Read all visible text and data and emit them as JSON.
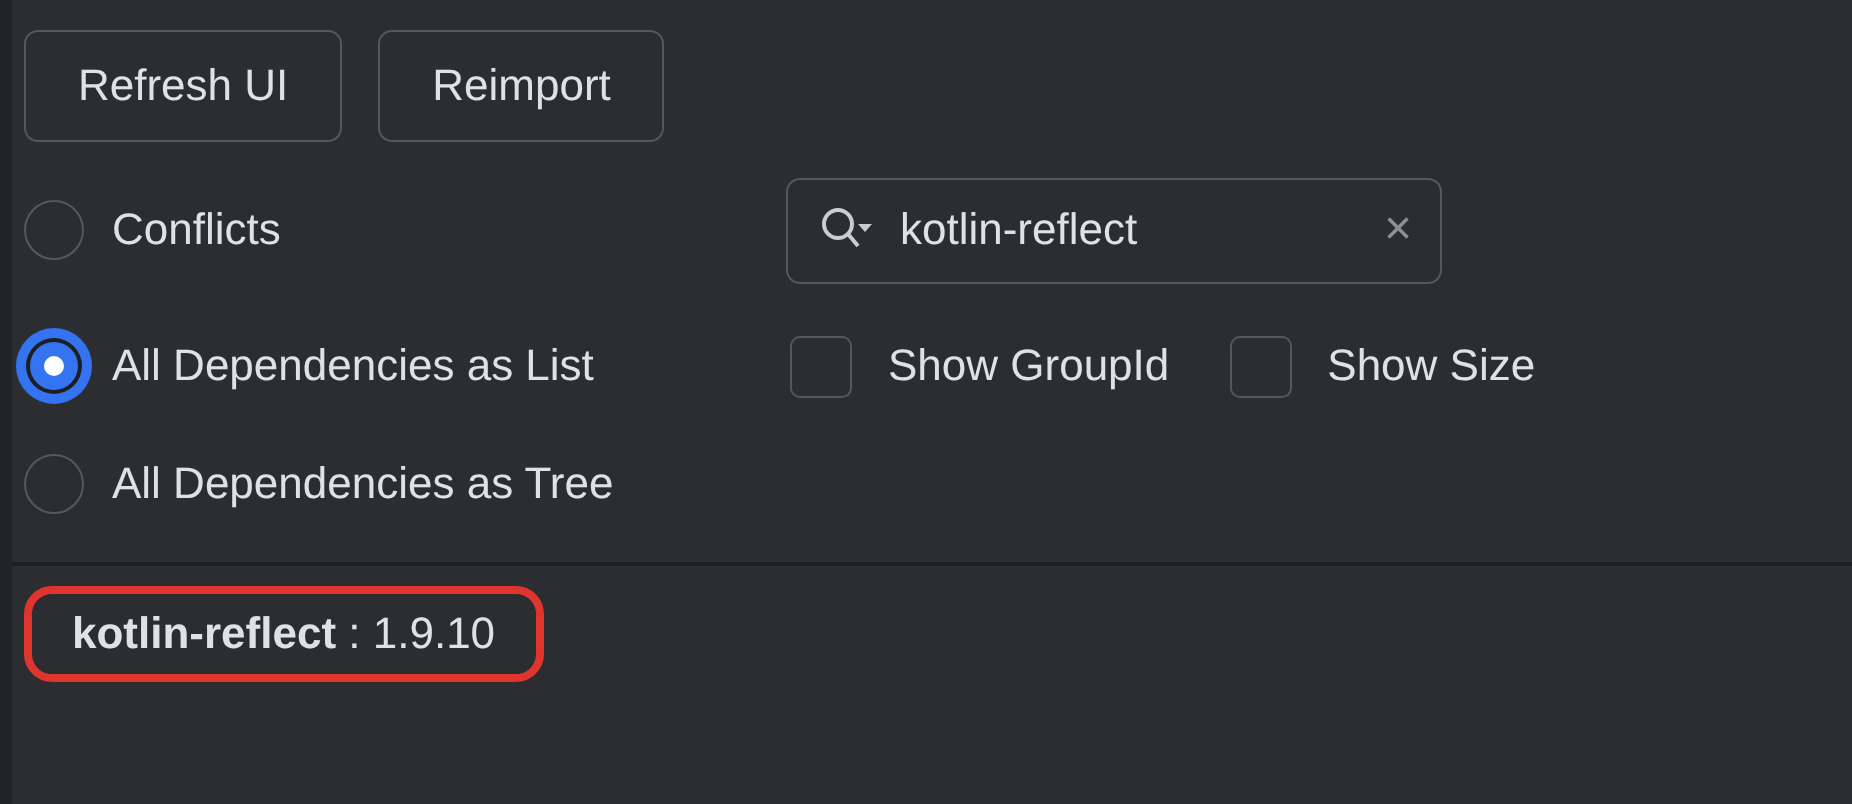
{
  "buttons": [
    "Refresh UI",
    "Reimport"
  ],
  "views": [
    {
      "label": "Conflicts",
      "selected": false
    },
    {
      "label": "All Dependencies as List",
      "selected": true
    },
    {
      "label": "All Dependencies as Tree",
      "selected": false
    }
  ],
  "search": {
    "value": "kotlin-reflect",
    "clear": "×"
  },
  "options": [
    {
      "label": "Show GroupId",
      "checked": false
    },
    {
      "label": "Show Size",
      "checked": false
    }
  ],
  "results": [
    {
      "text": "**kotlin-reflect** : 1.9.10",
      "highlighted": true
    }
  ]
}
